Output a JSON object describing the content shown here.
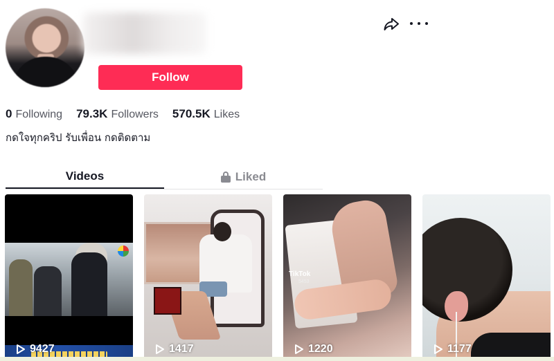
{
  "profile": {
    "follow_label": "Follow",
    "accent_color": "#fe2c55"
  },
  "stats": {
    "following_count": "0",
    "following_label": "Following",
    "followers_count": "79.3K",
    "followers_label": "Followers",
    "likes_count": "570.5K",
    "likes_label": "Likes"
  },
  "bio": "กดใจทุกคริป รับเพื่อน กดติดตาม",
  "tabs": [
    {
      "label": "Videos",
      "active": true
    },
    {
      "label": "Liked",
      "active": false,
      "icon": "lock-icon"
    }
  ],
  "videos": [
    {
      "views": "9427"
    },
    {
      "views": "1417"
    },
    {
      "views": "1220",
      "watermark": "TikTok",
      "watermark_id": "5453"
    },
    {
      "views": "1177"
    }
  ],
  "icons": {
    "share": "share-icon",
    "more": "more-icon",
    "play": "play-icon"
  }
}
